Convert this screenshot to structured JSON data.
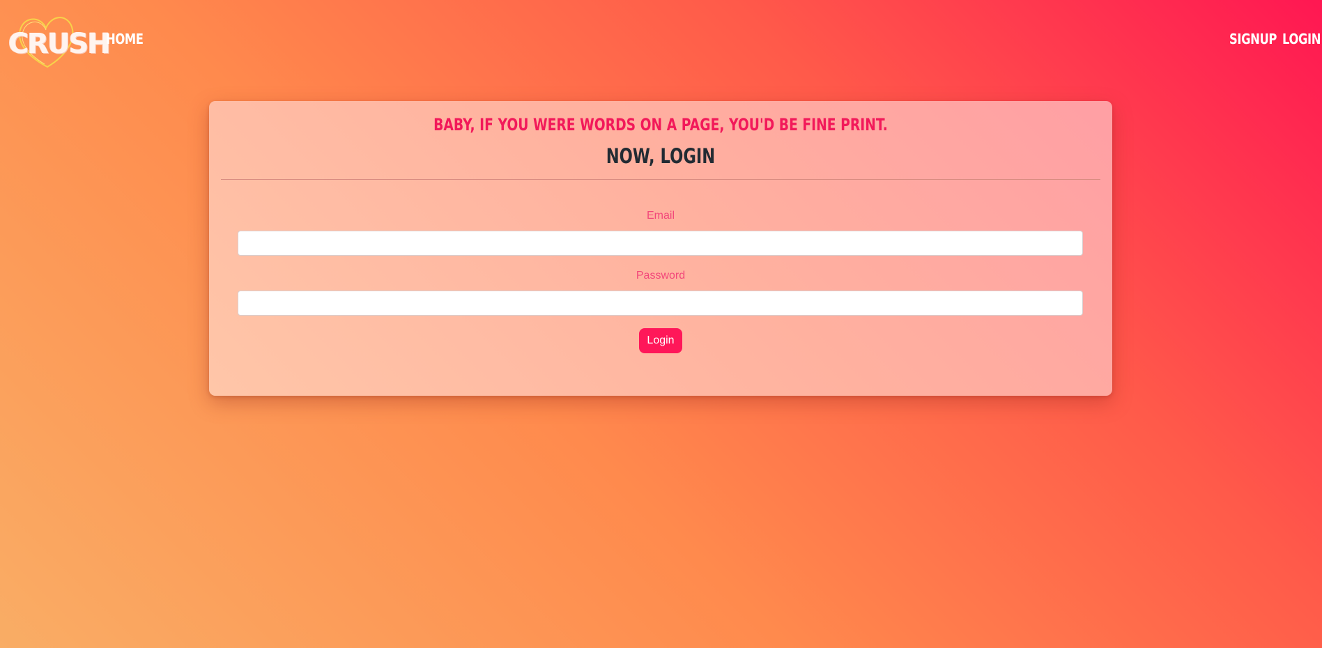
{
  "nav": {
    "logo_text": "CRUSH",
    "home_label": "HOME",
    "signup_label": "SIGNUP",
    "login_label": "LOGIN"
  },
  "card": {
    "pickup_line": "BABY, IF YOU WERE WORDS ON A PAGE, YOU'D BE FINE PRINT.",
    "heading": "NOW, LOGIN",
    "email_label": "Email",
    "email_value": "",
    "password_label": "Password",
    "password_value": "",
    "login_button": "Login"
  },
  "colors": {
    "accent": "#ff1759",
    "pickup_text": "#f2195a",
    "label_text": "#f2477a",
    "heading_text": "#222b33"
  },
  "icons": {
    "logo_icon": "heart-icon"
  }
}
